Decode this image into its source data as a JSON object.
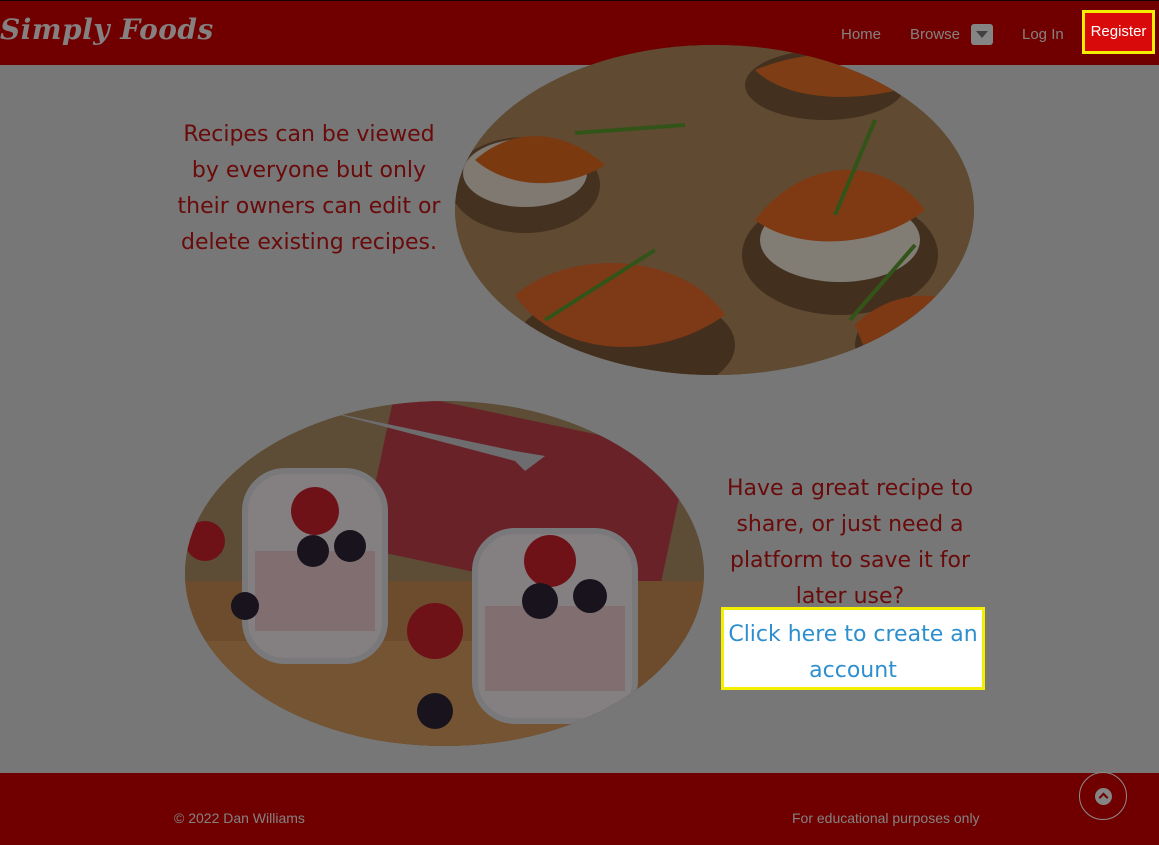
{
  "nav": {
    "brand": "Simply Foods",
    "links": [
      "Home",
      "Browse",
      "Log In"
    ],
    "register": "Register"
  },
  "sections": [
    {
      "text": "Recipes can be viewed by everyone but only their owners can edit or delete existing recipes."
    },
    {
      "text": "Have a great recipe to share, or just need a platform to save it for later use?",
      "link": "Click here to create an account"
    }
  ],
  "footer": {
    "copyright": "© 2022 Dan Williams",
    "note": "For educational purposes only"
  },
  "icons": {
    "browse_dropdown": "chevron-down-icon",
    "back_to_top": "chevron-up-icon"
  },
  "colors": {
    "brand_red": "#cc0000",
    "highlight_yellow": "#f4ee00",
    "link_blue": "#2e8fce"
  }
}
